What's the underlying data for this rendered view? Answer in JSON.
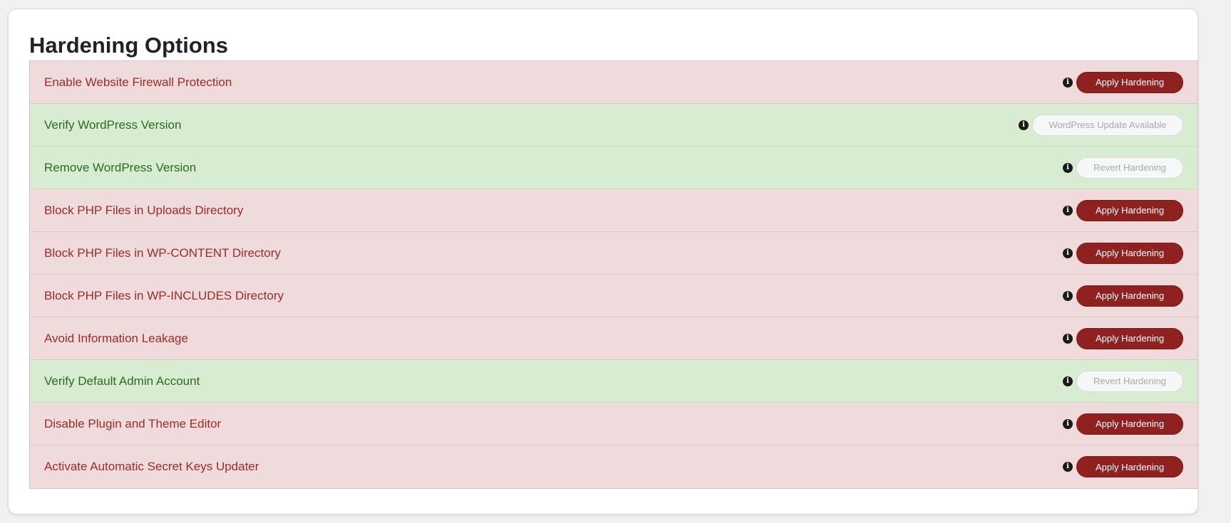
{
  "title": "Hardening Options",
  "colors": {
    "bad_bg": "#f0dbdc",
    "bad_text": "#9d2a2a",
    "good_bg": "#d8ecd2",
    "good_text": "#2a6b22",
    "apply_button": "#8f2121"
  },
  "options": [
    {
      "label": "Enable Website Firewall Protection",
      "status": "bad",
      "button": "Apply Hardening",
      "button_type": "apply",
      "icon": "info-icon"
    },
    {
      "label": "Verify WordPress Version",
      "status": "good",
      "button": "WordPress Update Available",
      "button_type": "update",
      "icon": "info-icon"
    },
    {
      "label": "Remove WordPress Version",
      "status": "good",
      "button": "Revert Hardening",
      "button_type": "revert",
      "icon": "info-icon"
    },
    {
      "label": "Block PHP Files in Uploads Directory",
      "status": "bad",
      "button": "Apply Hardening",
      "button_type": "apply",
      "icon": "info-icon"
    },
    {
      "label": "Block PHP Files in WP-CONTENT Directory",
      "status": "bad",
      "button": "Apply Hardening",
      "button_type": "apply",
      "icon": "info-icon"
    },
    {
      "label": "Block PHP Files in WP-INCLUDES Directory",
      "status": "bad",
      "button": "Apply Hardening",
      "button_type": "apply",
      "icon": "info-icon"
    },
    {
      "label": "Avoid Information Leakage",
      "status": "bad",
      "button": "Apply Hardening",
      "button_type": "apply",
      "icon": "info-icon"
    },
    {
      "label": "Verify Default Admin Account",
      "status": "good",
      "button": "Revert Hardening",
      "button_type": "revert",
      "icon": "info-icon"
    },
    {
      "label": "Disable Plugin and Theme Editor",
      "status": "bad",
      "button": "Apply Hardening",
      "button_type": "apply",
      "icon": "info-icon"
    },
    {
      "label": "Activate Automatic Secret Keys Updater",
      "status": "bad",
      "button": "Apply Hardening",
      "button_type": "apply",
      "icon": "info-icon"
    }
  ]
}
